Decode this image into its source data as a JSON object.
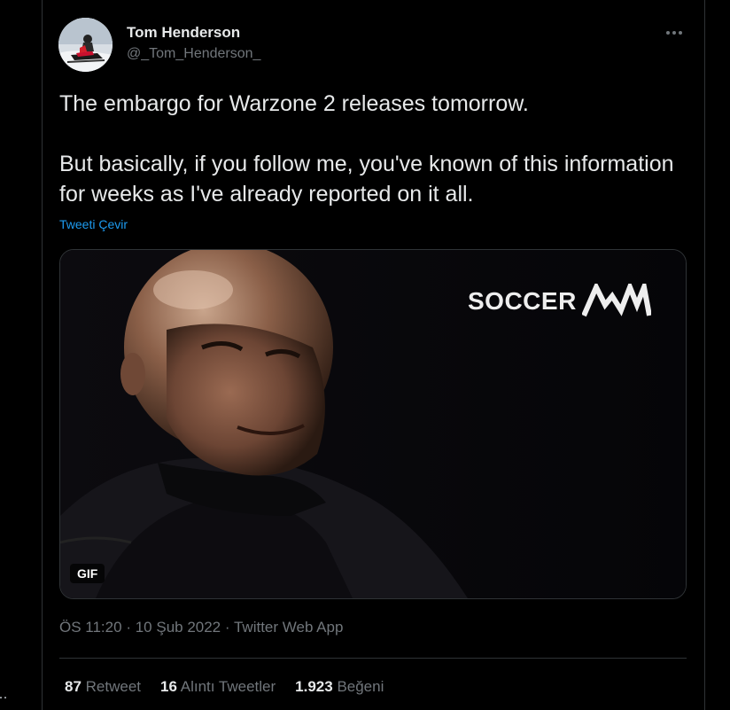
{
  "author": {
    "name": "Tom Henderson",
    "handle": "@_Tom_Henderson_",
    "avatar_icon": "snowmobile-rider-avatar"
  },
  "tweet": {
    "paragraphs": [
      "The embargo for Warzone 2 releases tomorrow.",
      "But basically, if you follow me, you've known of this information for weeks as I've already reported on it all."
    ],
    "translate_label": "Tweeti Çevir"
  },
  "media": {
    "type_badge": "GIF",
    "logo_text": "SOCCER",
    "logo_mark_icon": "am-wave-logo-icon"
  },
  "meta": {
    "time": "ÖS 11:20",
    "separator": "·",
    "date": "10 Şub 2022",
    "source": "Twitter Web App"
  },
  "stats": {
    "retweets": {
      "count": "87",
      "label": "Retweet"
    },
    "quotes": {
      "count": "16",
      "label": "Alıntı Tweetler"
    },
    "likes": {
      "count": "1.923",
      "label": "Beğeni"
    }
  },
  "colors": {
    "background": "#000000",
    "text_primary": "#e7e9ea",
    "text_secondary": "#71767b",
    "link": "#1d9bf0",
    "border": "#2f3336"
  }
}
